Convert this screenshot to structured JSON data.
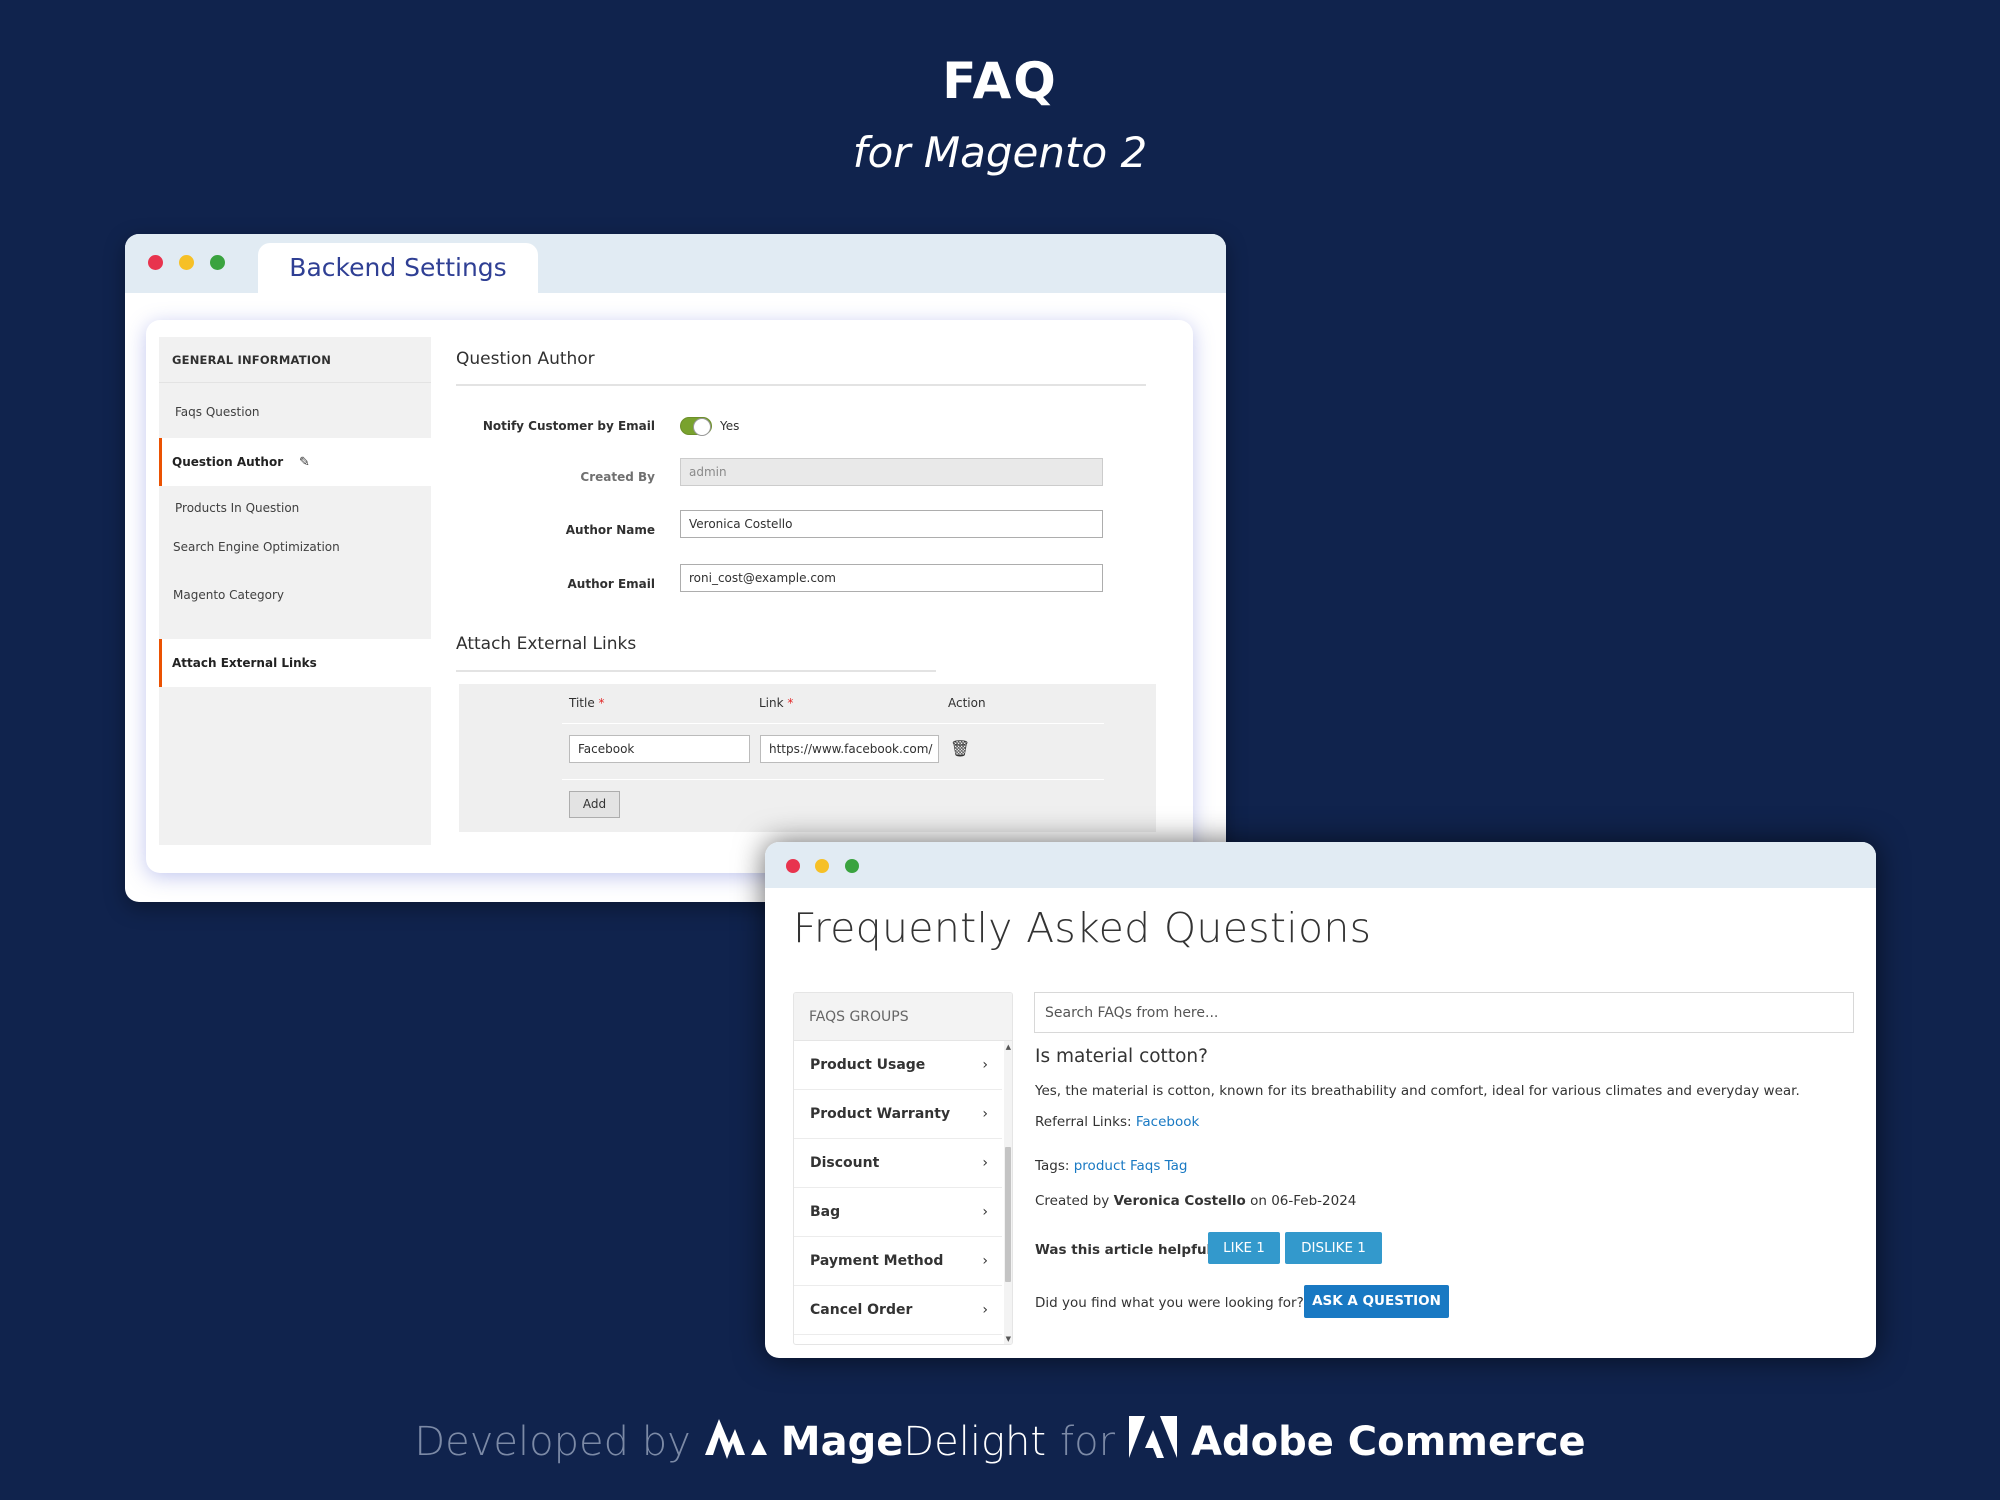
{
  "hero": {
    "title": "FAQ",
    "subtitle": "for Magento 2"
  },
  "backend_window": {
    "tab_label": "Backend Settings",
    "nav": {
      "header": "GENERAL INFORMATION",
      "items": [
        {
          "label": "Faqs Question",
          "active": false
        },
        {
          "label": "Question Author",
          "active": true,
          "icon": "pencil-icon"
        },
        {
          "label": "Products In Question",
          "active": false
        },
        {
          "label": "Search Engine Optimization",
          "active": false
        },
        {
          "label": "Magento Category",
          "active": false
        },
        {
          "label": "Attach External Links",
          "active": true
        }
      ]
    },
    "question_author": {
      "title": "Question Author",
      "notify_label": "Notify Customer by Email",
      "notify_value": "Yes",
      "notify_enabled": true,
      "created_by_label": "Created By",
      "created_by_value": "admin",
      "author_name_label": "Author Name",
      "author_name_value": "Veronica Costello",
      "author_email_label": "Author Email",
      "author_email_value": "roni_cost@example.com"
    },
    "external_links": {
      "title": "Attach External Links",
      "col_title": "Title",
      "col_link": "Link",
      "col_action": "Action",
      "required_mark": "*",
      "rows": [
        {
          "title": "Facebook",
          "link": "https://www.facebook.com/"
        }
      ],
      "add_label": "Add"
    }
  },
  "frontend_window": {
    "page_title": "Frequently Asked Questions",
    "groups_header": "FAQS GROUPS",
    "groups": [
      "Product Usage",
      "Product Warranty",
      "Discount",
      "Bag",
      "Payment Method",
      "Cancel Order"
    ],
    "search_placeholder": "Search FAQs from here...",
    "question": "Is material cotton?",
    "answer": "Yes, the material is cotton, known for its breathability and comfort, ideal for various climates and everyday wear.",
    "referral_label": "Referral Links:",
    "referral_link": "Facebook",
    "tags_label": "Tags:",
    "tags_value": "product Faqs Tag",
    "created_prefix": "Created by",
    "created_author": "Veronica Costello",
    "created_suffix": "on 06-Feb-2024",
    "helpful_label": "Was this article helpful ?",
    "like_label": "LIKE 1",
    "dislike_label": "DISLIKE 1",
    "find_label": "Did you find what you were looking for?",
    "ask_label": "ASK A QUESTION"
  },
  "footer": {
    "developed_by": "Developed by",
    "brand_bold": "Mage",
    "brand_light": "Delight",
    "for": "for",
    "platform": "Adobe Commerce"
  },
  "colors": {
    "background": "#10234d",
    "accent_orange": "#eb5202",
    "link_blue": "#1979c3",
    "button_light_blue": "#3399cc",
    "toggle_green": "#79a22e",
    "tab_text": "#2f3f94"
  }
}
